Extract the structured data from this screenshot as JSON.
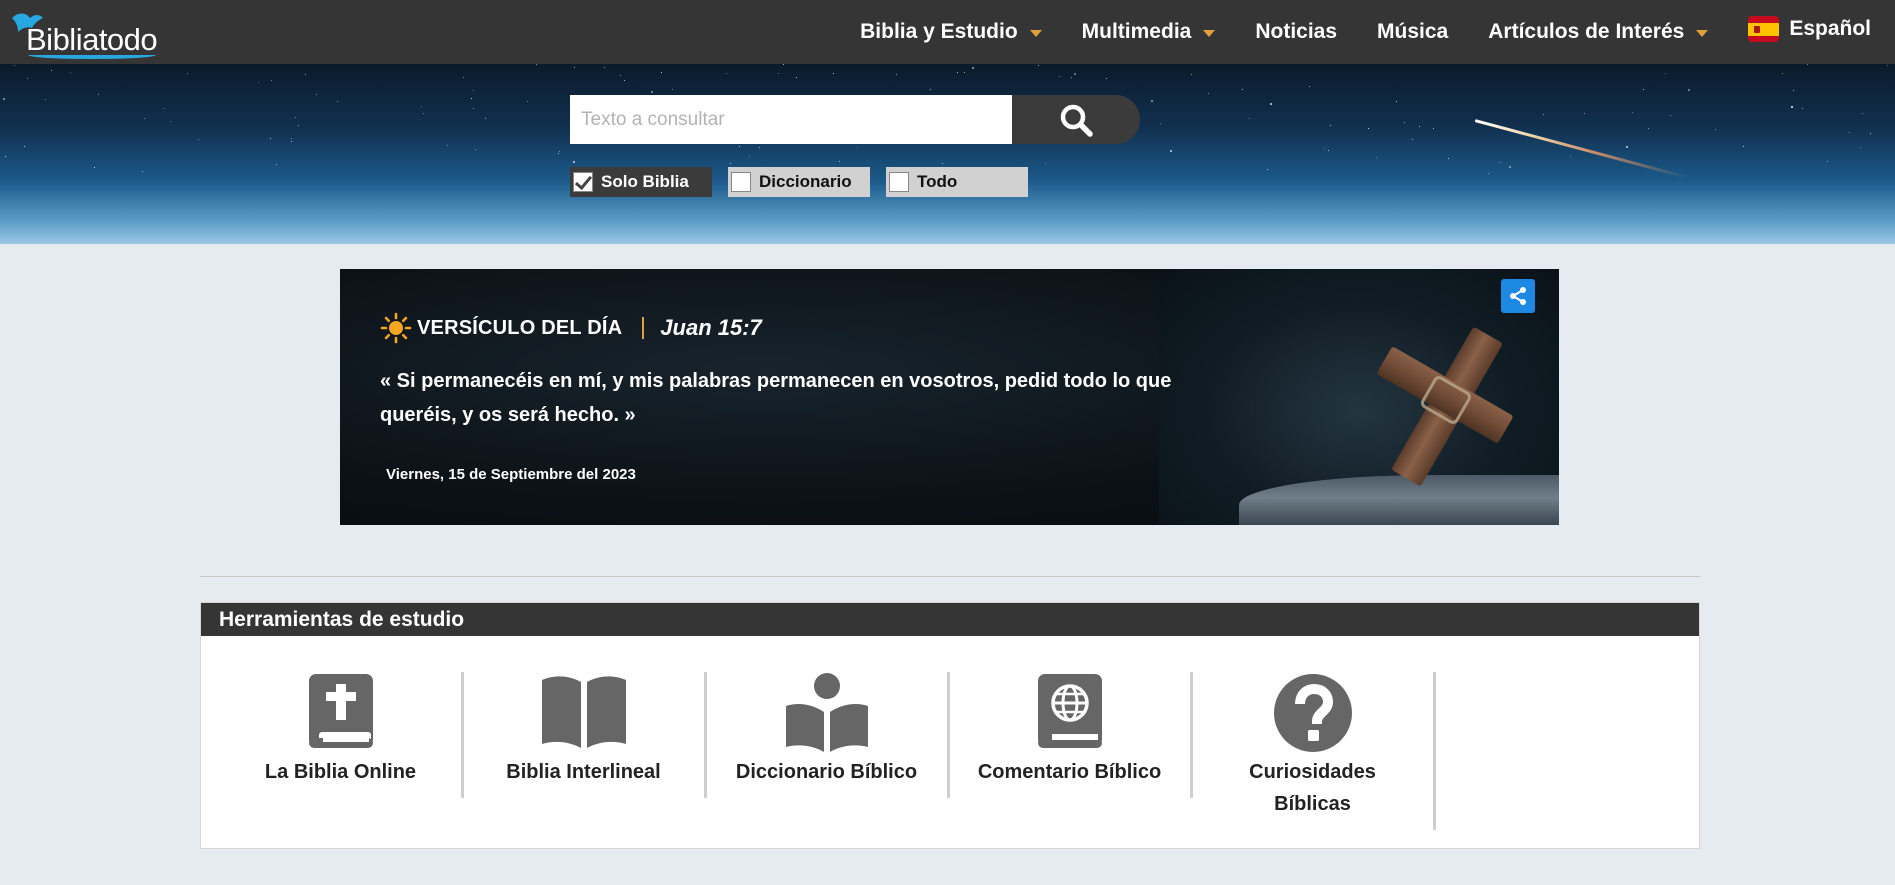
{
  "nav": {
    "logo_text": "Bibliatodo",
    "items": [
      {
        "label": "Biblia y Estudio",
        "has_dropdown": true
      },
      {
        "label": "Multimedia",
        "has_dropdown": true
      },
      {
        "label": "Noticias",
        "has_dropdown": false
      },
      {
        "label": "Música",
        "has_dropdown": false
      },
      {
        "label": "Artículos de Interés",
        "has_dropdown": true
      }
    ],
    "language": "Español",
    "language_flag_icon": "spain-flag-icon"
  },
  "search": {
    "placeholder": "Texto a consultar",
    "value": "",
    "button_icon": "search-icon",
    "filters": [
      {
        "label": "Solo Biblia",
        "checked": true
      },
      {
        "label": "Diccionario",
        "checked": false
      },
      {
        "label": "Todo",
        "checked": false
      }
    ]
  },
  "verse": {
    "label": "VERSÍCULO DEL DÍA",
    "reference": "Juan 15:7",
    "text": "« Si permanecéis en mí, y mis palabras permanecen en vosotros, pedid todo lo que queréis, y os será hecho. »",
    "date": "Viernes, 15 de Septiembre del 2023",
    "icons": [
      "sun-icon",
      "share-icon"
    ]
  },
  "tools": {
    "title": "Herramientas de estudio",
    "items": [
      {
        "label": "La Biblia Online",
        "icon": "bible-cross-icon"
      },
      {
        "label": "Biblia Interlineal",
        "icon": "open-book-icon"
      },
      {
        "label": "Diccionario Bíblico",
        "icon": "person-reading-icon"
      },
      {
        "label": "Comentario Bíblico",
        "icon": "globe-book-icon"
      },
      {
        "label": "Curiosidades Bíblicas",
        "icon": "question-circle-icon"
      }
    ]
  },
  "colors": {
    "nav_bg": "#353535",
    "accent_caret": "#e0a13a",
    "share_blue": "#1e88e5",
    "icon_gray": "#666666",
    "page_bg": "#e6ebf1"
  }
}
